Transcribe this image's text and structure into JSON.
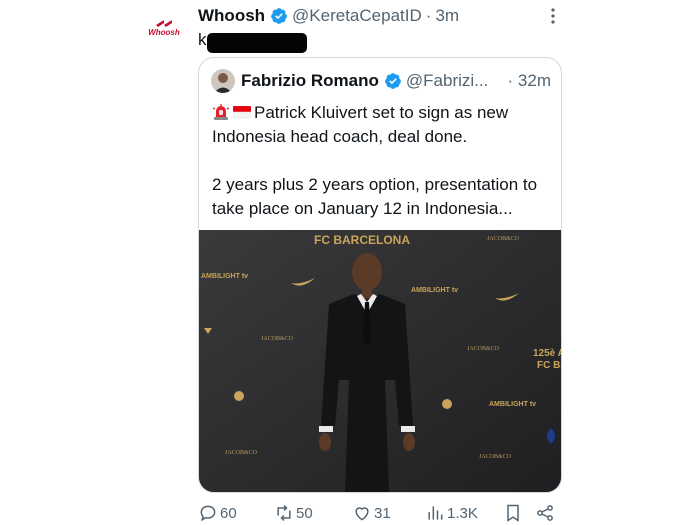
{
  "tweet": {
    "author_name": "Whoosh",
    "handle": "@KeretaCepatID",
    "separator": "·",
    "time": "3m",
    "avatar_logo_text": "Whoosh",
    "text": "k"
  },
  "quote": {
    "author_name": "Fabrizio Romano",
    "handle": "@Fabrizi...",
    "separator": "·",
    "time": "32m",
    "emojis": [
      "siren-emoji",
      "indonesia-flag-emoji"
    ],
    "line1": "Patrick Kluivert set to sign as new Indonesia head coach, deal done.",
    "line2": "2 years plus 2 years option, presentation to take place on January 12 in Indonesia...",
    "photo": {
      "signage": [
        "FC BARCELONA",
        "AMBILIGHT tv",
        "AMBILIGHT tv",
        "AMBILIGHT tv",
        "JACOB&CO",
        "JACOB&CO",
        "JACOB&CO",
        "JACOB&CO",
        "125è A",
        "FC BA"
      ]
    }
  },
  "actions": {
    "replies": "60",
    "reposts": "50",
    "likes": "31",
    "views": "1.3K"
  },
  "colors": {
    "verified": "#1d9bf0",
    "muted": "#536471",
    "border": "#cfd9de",
    "brand_red": "#c8102e"
  }
}
